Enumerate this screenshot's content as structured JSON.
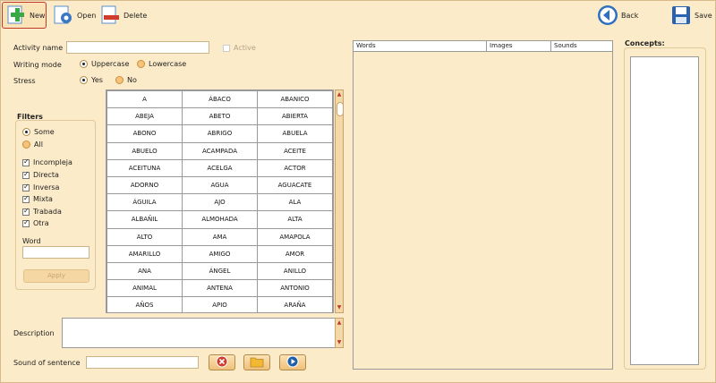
{
  "toolbar": {
    "new_label": "New",
    "open_label": "Open",
    "delete_label": "Delete",
    "back_label": "Back",
    "save_label": "Save"
  },
  "form": {
    "activity_name_label": "Activity name",
    "activity_name_value": "",
    "active_label": "Active",
    "writing_mode_label": "Writing mode",
    "writing_mode_options": [
      "Uppercase",
      "Lowercase"
    ],
    "writing_mode_selected": "Uppercase",
    "stress_label": "Stress",
    "stress_options": [
      "Yes",
      "No"
    ],
    "stress_selected": "Yes",
    "description_label": "Description",
    "description_value": "",
    "sound_label": "Sound of sentence",
    "sound_value": ""
  },
  "filters": {
    "title": "Filters",
    "scope_options": [
      "Some",
      "All"
    ],
    "scope_selected": "Some",
    "checkboxes": [
      {
        "label": "Incompleja",
        "checked": true
      },
      {
        "label": "Directa",
        "checked": true
      },
      {
        "label": "Inversa",
        "checked": true
      },
      {
        "label": "Mixta",
        "checked": true
      },
      {
        "label": "Trabada",
        "checked": true
      },
      {
        "label": "Otra",
        "checked": true
      }
    ],
    "word_label": "Word",
    "word_value": "",
    "apply_label": "Apply"
  },
  "word_grid": [
    [
      "A",
      "ÁBACO",
      "ABANICO"
    ],
    [
      "ABEJA",
      "ABETO",
      "ABIERTA"
    ],
    [
      "ABONO",
      "ABRIGO",
      "ABUELA"
    ],
    [
      "ABUELO",
      "ACAMPADA",
      "ACEITE"
    ],
    [
      "ACEITUNA",
      "ACELGA",
      "ACTOR"
    ],
    [
      "ADORNO",
      "AGUA",
      "AGUACATE"
    ],
    [
      "ÁGUILA",
      "AJO",
      "ALA"
    ],
    [
      "ALBAÑIL",
      "ALMOHADA",
      "ALTA"
    ],
    [
      "ALTO",
      "AMA",
      "AMAPOLA"
    ],
    [
      "AMARILLO",
      "AMIGO",
      "AMOR"
    ],
    [
      "ANA",
      "ÁNGEL",
      "ANILLO"
    ],
    [
      "ANIMAL",
      "ANTENA",
      "ANTONIO"
    ],
    [
      "AÑOS",
      "APIO",
      "ARAÑA"
    ]
  ],
  "words_table": {
    "headers": [
      "Words",
      "Images",
      "Sounds"
    ]
  },
  "concepts": {
    "title": "Concepts:"
  },
  "colors": {
    "background": "#fcebc8",
    "accent_red": "#c0392b",
    "button_orange": "#f0c07a"
  },
  "icons": [
    "new-icon",
    "open-icon",
    "delete-icon",
    "back-icon",
    "save-icon",
    "cancel-icon",
    "folder-icon",
    "play-icon"
  ]
}
